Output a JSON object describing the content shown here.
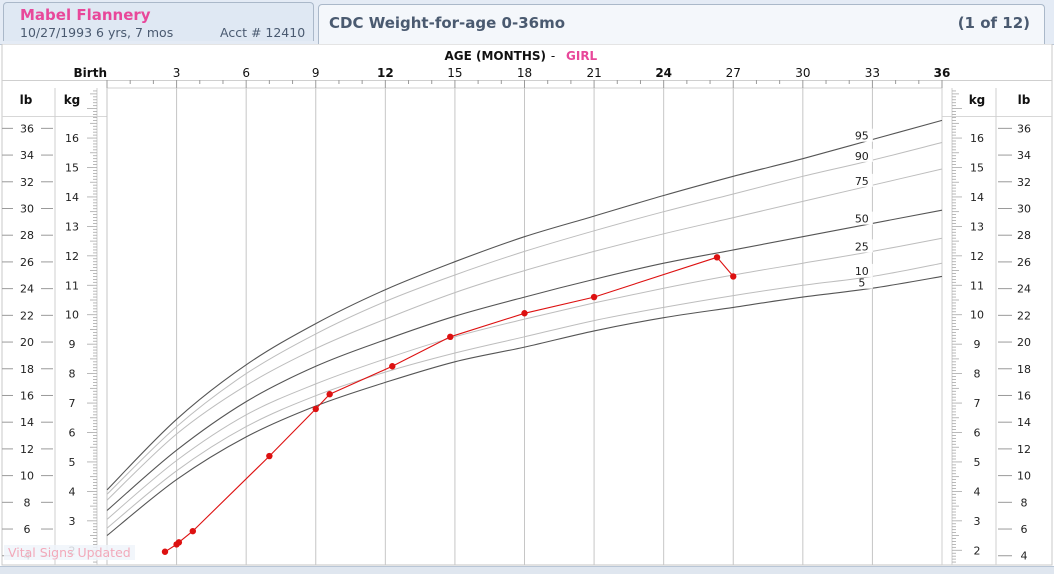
{
  "patient": {
    "name": "Mabel Flannery",
    "dob_age": "10/27/1993   6 yrs, 7 mos",
    "account": "Acct # 12410"
  },
  "chart_tab": {
    "title": "CDC Weight-for-age 0-36mo",
    "page": "(1 of 12)"
  },
  "status_note": "Vital Signs Updated",
  "colors": {
    "header_bg": "#e4ebf5",
    "patient_name": "#e8479a",
    "girl_label": "#e8479a",
    "patient_series": "#dd1111",
    "percentile_dark": "#555555",
    "percentile_light": "#bdbdbd"
  },
  "chart_data": {
    "type": "line",
    "title": "AGE (MONTHS)",
    "gender_label": "GIRL",
    "xlim": [
      0,
      36
    ],
    "ylim_kg": [
      1.5,
      17.7
    ],
    "x_ticks": [
      {
        "label": "Birth",
        "value": 0,
        "bold": true
      },
      {
        "label": "3",
        "value": 3,
        "bold": false
      },
      {
        "label": "6",
        "value": 6,
        "bold": false
      },
      {
        "label": "9",
        "value": 9,
        "bold": false
      },
      {
        "label": "12",
        "value": 12,
        "bold": true
      },
      {
        "label": "15",
        "value": 15,
        "bold": false
      },
      {
        "label": "18",
        "value": 18,
        "bold": false
      },
      {
        "label": "21",
        "value": 21,
        "bold": false
      },
      {
        "label": "24",
        "value": 24,
        "bold": true
      },
      {
        "label": "27",
        "value": 27,
        "bold": false
      },
      {
        "label": "30",
        "value": 30,
        "bold": false
      },
      {
        "label": "33",
        "value": 33,
        "bold": false
      },
      {
        "label": "36",
        "value": 36,
        "bold": true
      }
    ],
    "left_axes": {
      "lb_header": "lb",
      "kg_header": "kg"
    },
    "right_axes": {
      "kg_header": "kg",
      "lb_header": "lb"
    },
    "kg_ticks": [
      "2",
      "3",
      "4",
      "5",
      "6",
      "7",
      "8",
      "9",
      "10",
      "11",
      "12",
      "13",
      "14",
      "15",
      "16"
    ],
    "lb_ticks": [
      "4",
      "6",
      "8",
      "10",
      "12",
      "14",
      "16",
      "18",
      "20",
      "22",
      "24",
      "26",
      "28",
      "30",
      "32",
      "34",
      "36"
    ],
    "x": [
      0,
      3,
      6,
      9,
      12,
      15,
      18,
      21,
      24,
      27,
      30,
      33,
      36
    ],
    "percentiles": [
      {
        "name": "5",
        "style": "dark",
        "values": [
          2.5,
          4.4,
          5.85,
          6.9,
          7.7,
          8.4,
          8.9,
          9.45,
          9.9,
          10.25,
          10.6,
          10.9,
          11.3
        ]
      },
      {
        "name": "10",
        "style": "light",
        "values": [
          2.75,
          4.7,
          6.2,
          7.25,
          8.05,
          8.7,
          9.25,
          9.8,
          10.25,
          10.65,
          11.0,
          11.3,
          11.75
        ]
      },
      {
        "name": "25",
        "style": "light",
        "values": [
          3.05,
          5.05,
          6.6,
          7.65,
          8.5,
          9.25,
          9.85,
          10.4,
          10.9,
          11.35,
          11.75,
          12.15,
          12.6
        ]
      },
      {
        "name": "50",
        "style": "dark",
        "values": [
          3.35,
          5.4,
          7.05,
          8.25,
          9.15,
          9.95,
          10.6,
          11.2,
          11.75,
          12.2,
          12.65,
          13.1,
          13.55
        ]
      },
      {
        "name": "75",
        "style": "light",
        "values": [
          3.7,
          5.95,
          7.6,
          8.85,
          9.85,
          10.75,
          11.5,
          12.15,
          12.75,
          13.3,
          13.85,
          14.4,
          14.95
        ]
      },
      {
        "name": "90",
        "style": "light",
        "values": [
          3.9,
          6.2,
          8.0,
          9.35,
          10.45,
          11.35,
          12.15,
          12.85,
          13.5,
          14.1,
          14.7,
          15.25,
          15.85
        ]
      },
      {
        "name": "95",
        "style": "dark",
        "values": [
          4.05,
          6.45,
          8.3,
          9.7,
          10.85,
          11.8,
          12.65,
          13.35,
          14.05,
          14.7,
          15.3,
          15.95,
          16.6
        ]
      }
    ],
    "patient_series": {
      "x": [
        2.5,
        3.0,
        3.1,
        3.7,
        7.0,
        9.0,
        9.6,
        12.3,
        14.8,
        18.0,
        21.0,
        26.3,
        27.0
      ],
      "y": [
        1.95,
        2.2,
        2.27,
        2.65,
        5.2,
        6.8,
        7.3,
        8.25,
        9.25,
        10.05,
        10.6,
        11.95,
        11.3
      ]
    }
  }
}
